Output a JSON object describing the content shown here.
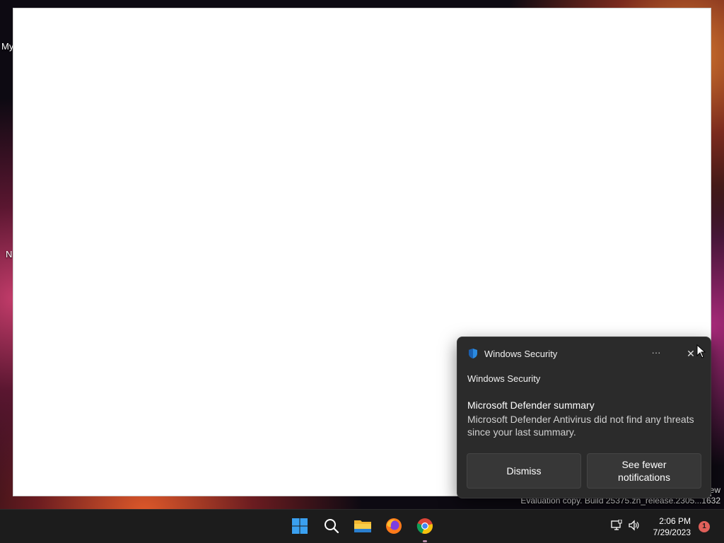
{
  "desktop": {
    "labels": [
      {
        "text": "My"
      },
      {
        "text": "N"
      }
    ],
    "watermark": {
      "line1": "ew",
      "line2": "Evaluation copy. Build 25375.zn_release.2305...1632"
    }
  },
  "toast": {
    "app_name": "Windows Security",
    "attribution": "Windows Security",
    "title": "Microsoft Defender summary",
    "body": "Microsoft Defender Antivirus did not find any threats since your last summary.",
    "more_label": "···",
    "close_label": "✕",
    "buttons": {
      "dismiss": "Dismiss",
      "see_fewer": "See fewer notifications"
    },
    "colors": {
      "background": "#2b2b2b",
      "button": "#373737",
      "shield": "#2b8ae0"
    }
  },
  "taskbar": {
    "apps": [
      {
        "name": "start-icon"
      },
      {
        "name": "search-icon"
      },
      {
        "name": "file-explorer-icon"
      },
      {
        "name": "firefox-icon"
      },
      {
        "name": "chrome-icon"
      }
    ],
    "clock": {
      "time": "2:06 PM",
      "date": "7/29/2023"
    },
    "notification_count": "1"
  }
}
